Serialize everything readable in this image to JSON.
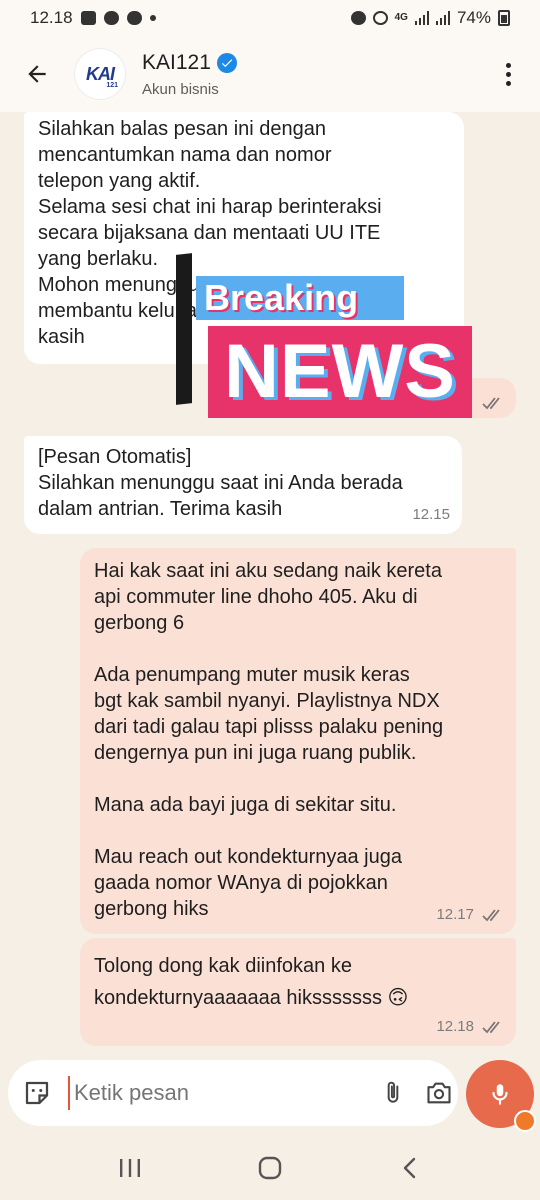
{
  "status": {
    "time": "12.18",
    "network": "4G",
    "battery": "74%"
  },
  "header": {
    "name": "KAI121",
    "subtitle": "Akun bisnis",
    "logo_text": "KAI",
    "logo_num": "121"
  },
  "messages": [
    {
      "dir": "in",
      "text": "Silahkan balas pesan ini dengan\nmencantumkan nama dan nomor\ntelepon yang aktif.\nSelama sesi chat ini harap berinteraksi\nsecara bijaksana dan mentaati UU ITE\nyang berlaku.\nMohon menunggu, kami akan segera\nmembantu keluhan Anda. Terima\nkasih",
      "time": ""
    },
    {
      "dir": "in",
      "text": "[Pesan Otomatis]\nSilahkan menunggu saat ini Anda berada\ndalam antrian. Terima kasih",
      "time": "12.15"
    },
    {
      "dir": "out",
      "text": "Hai kak saat ini aku sedang naik kereta\napi commuter line dhoho 405. Aku di\ngerbong 6\n\nAda penumpang muter musik keras\nbgt kak sambil nyanyi. Playlistnya NDX\ndari tadi galau tapi plisss palaku pening\ndengernya pun ini juga ruang publik.\n\nMana ada bayi juga di sekitar situ.\n\nMau reach out kondekturnyaa juga\ngaada nomor WAnya di pojokkan\ngerbong hiks",
      "time": "12.17"
    },
    {
      "dir": "out",
      "text": "Tolong dong kak diinfokan ke\nkondekturnyaaaaaaa hiksssssss 🙃",
      "time": "12.18"
    }
  ],
  "overlay": {
    "breaking": "Breaking",
    "news": "NEWS"
  },
  "composer": {
    "placeholder": "Ketik pesan"
  },
  "colors": {
    "bg": "#f6efe6",
    "out_bubble": "#fbe0d6",
    "in_bubble": "#ffffff",
    "accent": "#e66a4b",
    "verified": "#1e88e5"
  },
  "icons": [
    "back-arrow-icon",
    "verified-icon",
    "more-vert-icon",
    "sticker-icon",
    "attach-icon",
    "camera-icon",
    "mic-icon",
    "double-check-icon",
    "recents-icon",
    "home-icon",
    "back-nav-icon"
  ]
}
